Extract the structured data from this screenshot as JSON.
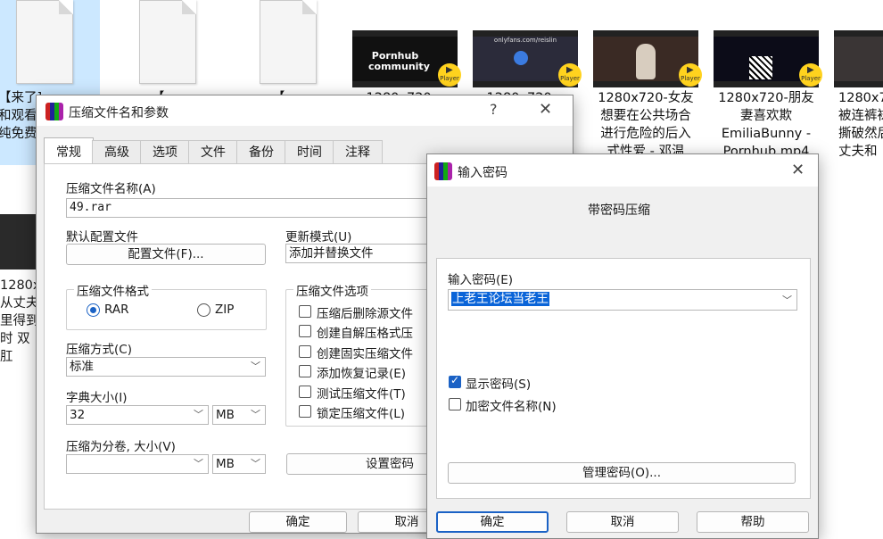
{
  "explorer": {
    "tiles": [
      {
        "type": "doc",
        "caption": "【来了]...\n和观看\n纯免费",
        "selected": true
      },
      {
        "type": "doc",
        "caption": "【...",
        "selected": false
      },
      {
        "type": "doc",
        "caption": "【...",
        "selected": false
      },
      {
        "type": "video",
        "thumb": "Pornhub community",
        "caption": "1280x720...",
        "selected": false
      },
      {
        "type": "video",
        "thumb": "onlyfans.com/reislin",
        "caption": "1280x720...",
        "selected": false
      },
      {
        "type": "video",
        "thumb": "",
        "caption": "1280x720-女友\n想要在公共场合\n进行危险的后入\n式性爱 - 邓温",
        "selected": false
      },
      {
        "type": "video",
        "thumb": "",
        "caption": "1280x720-朋友\n妻喜欢欺\nEmiliaBunny -\nPornhub.mp4",
        "selected": false
      },
      {
        "type": "video",
        "thumb": "",
        "caption": "1280x7\n被连裤袜\n撕破然后\n丈夫和",
        "selected": false
      }
    ],
    "left_partial": [
      "1280x",
      "从丈夫",
      "里得到",
      "时 双肛"
    ],
    "player_badge": "Player"
  },
  "archive_dialog": {
    "title": "压缩文件名和参数",
    "help_btn": "?",
    "close_btn": "✕",
    "tabs": [
      "常规",
      "高级",
      "选项",
      "文件",
      "备份",
      "时间",
      "注释"
    ],
    "archive_name_label": "压缩文件名称(A)",
    "archive_name_value": "49.rar",
    "profile_label": "默认配置文件",
    "profile_button": "配置文件(F)...",
    "update_mode_label": "更新模式(U)",
    "update_mode_value": "添加并替换文件",
    "format_group": "压缩文件格式",
    "format_rar": "RAR",
    "format_zip": "ZIP",
    "options_group": "压缩文件选项",
    "options": [
      {
        "label": "压缩后删除源文件",
        "checked": false
      },
      {
        "label": "创建自解压格式压",
        "checked": false
      },
      {
        "label": "创建固实压缩文件",
        "checked": false
      },
      {
        "label": "添加恢复记录(E)",
        "checked": false
      },
      {
        "label": "测试压缩文件(T)",
        "checked": false
      },
      {
        "label": "锁定压缩文件(L)",
        "checked": false
      }
    ],
    "method_label": "压缩方式(C)",
    "method_value": "标准",
    "dict_label": "字典大小(I)",
    "dict_value": "32",
    "dict_unit": "MB",
    "split_label": "压缩为分卷, 大小(V)",
    "split_value": "",
    "split_unit": "MB",
    "set_password_button": "设置密码",
    "ok_button": "确定",
    "cancel_button": "取消"
  },
  "password_dialog": {
    "title": "输入密码",
    "close_btn": "✕",
    "heading": "带密码压缩",
    "password_label": "输入密码(E)",
    "password_value": "上老王论坛当老王",
    "show_password_label": "显示密码(S)",
    "show_password_checked": true,
    "encrypt_names_label": "加密文件名称(N)",
    "encrypt_names_checked": false,
    "manage_button": "管理密码(O)...",
    "ok_button": "确定",
    "cancel_button": "取消",
    "help_button": "帮助"
  },
  "colors": {
    "accent": "#1b62c5",
    "selection": "#cce8ff",
    "highlight": "#0a64d8",
    "badge": "#ffd21e"
  }
}
